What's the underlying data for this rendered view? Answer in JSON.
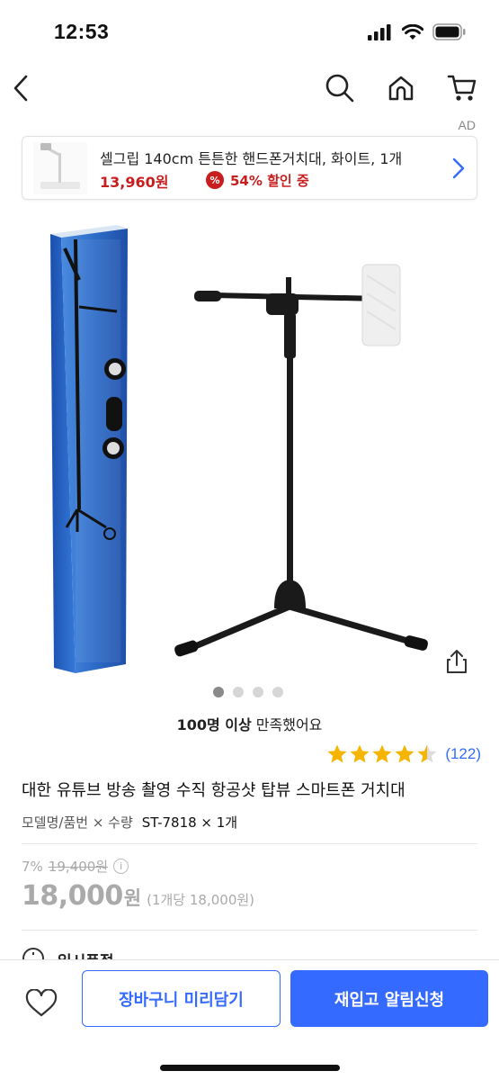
{
  "status_bar": {
    "time": "12:53"
  },
  "icons": {
    "back": "chevron-left-icon",
    "search": "search-icon",
    "home": "home-icon",
    "cart": "cart-icon",
    "share": "share-icon",
    "wishlist": "heart-icon",
    "info": "info-icon"
  },
  "ad": {
    "label": "AD",
    "title": "셀그립 140cm 튼튼한 핸드폰거치대, 화이트, 1개",
    "price": "13,960원",
    "badge": "%",
    "discount": "54% 할인 중"
  },
  "gallery": {
    "total": 4,
    "active": 1
  },
  "satisfaction": {
    "bold": "100명 이상",
    "text": " 만족했어요"
  },
  "rating": {
    "stars": 4.5,
    "review_count": "(122)"
  },
  "product": {
    "title": "대한 유튜브 방송 촬영 수직 항공샷 탑뷰 스마트폰 거치대",
    "option_label": "모델명/품번 × 수량",
    "option_value": "ST-7818 × 1개"
  },
  "pricing": {
    "discount_rate": "7%",
    "original_price": "19,400원",
    "sale_price": "18,000",
    "currency": "원",
    "unit_price": "(1개당 18,000원)"
  },
  "partial_section": {
    "label": "일시품절"
  },
  "bottom_bar": {
    "cart_button": "장바구니 미리담기",
    "restock_button": "재입고 알림신청"
  },
  "colors": {
    "accent": "#346aff",
    "sale_red": "#c81e1e",
    "star": "#f5b400",
    "muted": "#aaaaaa"
  }
}
